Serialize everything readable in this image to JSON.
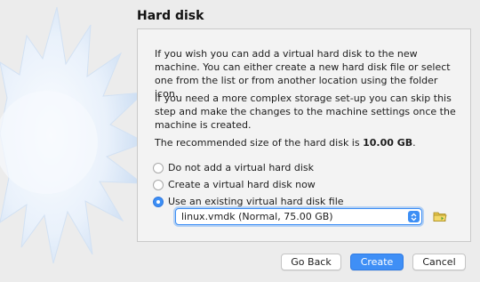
{
  "page": {
    "title": "Hard disk"
  },
  "content": {
    "paragraph_1": "If you wish you can add a virtual hard disk to the new machine. You can either create a new hard disk file or select one from the list or from another location using the folder icon.",
    "paragraph_2": "If you need a more complex storage set-up you can skip this step and make the changes to the machine settings once the machine is created.",
    "recommended_prefix": "The recommended size of the hard disk is ",
    "recommended_size": "10.00 GB",
    "recommended_suffix": "."
  },
  "options": {
    "selected": "use_existing",
    "items": [
      {
        "id": "none",
        "label": "Do not add a virtual hard disk"
      },
      {
        "id": "create",
        "label": "Create a virtual hard disk now"
      },
      {
        "id": "use_existing",
        "label": "Use an existing virtual hard disk file"
      }
    ]
  },
  "disk_select": {
    "value": "linux.vmdk (Normal, 75.00 GB)",
    "arrows_icon": "updown-chevron-icon"
  },
  "folder_button": {
    "icon": "folder-icon"
  },
  "buttons": {
    "back": "Go Back",
    "create": "Create",
    "cancel": "Cancel"
  },
  "colors": {
    "accent": "#3d8ff5",
    "background": "#ececec",
    "panel": "#f3f3f3"
  }
}
